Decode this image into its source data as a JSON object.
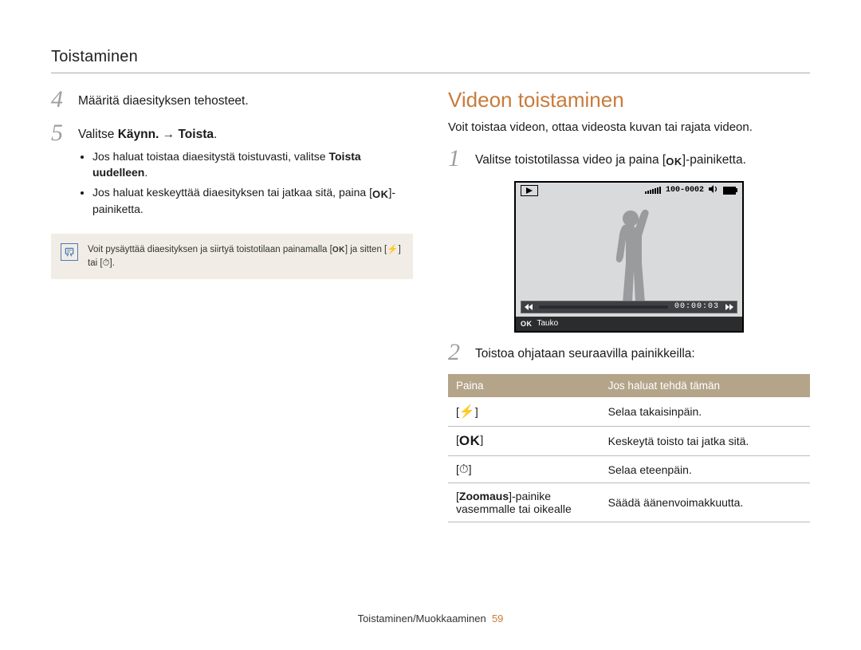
{
  "section_title": "Toistaminen",
  "left": {
    "step4": {
      "num": "4",
      "text": "Määritä diaesityksen tehosteet."
    },
    "step5": {
      "num": "5",
      "main_prefix": "Valitse ",
      "main_bold": "Käynn. → Toista",
      "main_suffix": ".",
      "bullet1_a": "Jos haluat toistaa diaesitystä toistuvasti, valitse ",
      "bullet1_bold": "Toista uudelleen",
      "bullet1_b": ".",
      "bullet2_a": "Jos haluat keskeyttää diaesityksen tai jatkaa sitä, paina [",
      "bullet2_ok": "OK",
      "bullet2_b": "]-painiketta."
    },
    "note": {
      "a": "Voit pysäyttää diaesityksen ja siirtyä toistotilaan painamalla [",
      "ok": "OK",
      "b": "] ja sitten [",
      "flash": "⚡",
      "c": "] tai [",
      "timer": "⏱",
      "d": "]."
    }
  },
  "right": {
    "heading": "Videon toistaminen",
    "intro": "Voit toistaa videon, ottaa videosta kuvan tai rajata videon.",
    "step1": {
      "num": "1",
      "a": "Valitse toistotilassa video ja paina [",
      "ok": "OK",
      "b": "]-painiketta."
    },
    "camera": {
      "counter": "100-0002",
      "timestamp": "00:00:03",
      "pause_label": "Tauko",
      "ok_label": "OK"
    },
    "step2": {
      "num": "2",
      "text": "Toistoa ohjataan seuraavilla painikkeilla:"
    },
    "table": {
      "head1": "Paina",
      "head2": "Jos haluat tehdä tämän",
      "rows": [
        {
          "key_l": "[",
          "icon": "⚡",
          "key_r": "]",
          "desc": "Selaa takaisinpäin."
        },
        {
          "key_l": "[",
          "icon": "OK",
          "key_r": "]",
          "desc": "Keskeytä toisto tai jatka sitä."
        },
        {
          "key_l": "[",
          "icon": "⏱",
          "key_r": "]",
          "desc": "Selaa eteenpäin."
        }
      ],
      "zoom_row": {
        "key_bold": "Zoomaus",
        "key_rest": "-painike vasemmalle tai oikealle",
        "desc": "Säädä äänenvoimakkuutta."
      }
    }
  },
  "footer": {
    "label": "Toistaminen/Muokkaaminen",
    "page": "59"
  }
}
